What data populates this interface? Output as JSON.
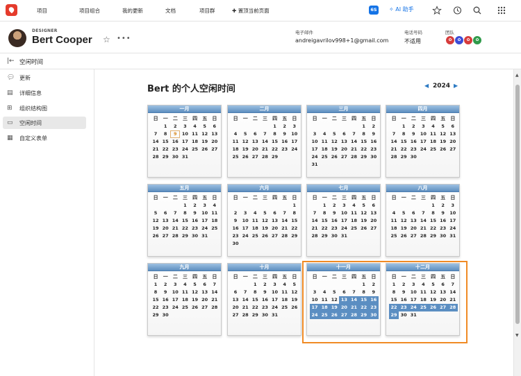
{
  "topnav": {
    "items": [
      "项目",
      "项目组合",
      "我的更新",
      "文档",
      "项目群"
    ],
    "pin_label": "置顶当前页面",
    "badge": "6S",
    "ai_label": "AI 助手"
  },
  "header": {
    "role": "DESIGNER",
    "name": "Bert Cooper",
    "email_label": "电子邮件",
    "email": "andreigavrilov998+1@gmail.com",
    "phone_label": "电话号码",
    "phone": "不适用",
    "team_label": "团队"
  },
  "subheader": {
    "title": "空闲时间"
  },
  "sidebar": {
    "items": [
      {
        "label": "更新",
        "icon": "chat-icon"
      },
      {
        "label": "详细信息",
        "icon": "document-icon"
      },
      {
        "label": "组织结构图",
        "icon": "org-chart-icon"
      },
      {
        "label": "空闲时间",
        "icon": "calendar-icon"
      },
      {
        "label": "自定义表单",
        "icon": "form-icon"
      }
    ],
    "active_index": 3
  },
  "main": {
    "title": "Bert 的个人空闲时间",
    "year": "2024"
  },
  "calendar": {
    "weekdays": [
      "日",
      "一",
      "二",
      "三",
      "四",
      "五",
      "日"
    ],
    "months": [
      {
        "name": "一月",
        "start": 1,
        "days": 31,
        "today": 9,
        "off": []
      },
      {
        "name": "二月",
        "start": 4,
        "days": 29,
        "off": []
      },
      {
        "name": "三月",
        "start": 5,
        "days": 31,
        "off": []
      },
      {
        "name": "四月",
        "start": 1,
        "days": 30,
        "off": []
      },
      {
        "name": "五月",
        "start": 3,
        "days": 31,
        "off": []
      },
      {
        "name": "六月",
        "start": 6,
        "days": 30,
        "off": []
      },
      {
        "name": "七月",
        "start": 1,
        "days": 31,
        "off": []
      },
      {
        "name": "八月",
        "start": 4,
        "days": 31,
        "off": []
      },
      {
        "name": "九月",
        "start": 0,
        "days": 30,
        "off": []
      },
      {
        "name": "十月",
        "start": 2,
        "days": 31,
        "off": []
      },
      {
        "name": "十一月",
        "start": 5,
        "days": 30,
        "off": [
          13,
          14,
          15,
          16,
          17,
          18,
          19,
          20,
          21,
          22,
          23,
          24,
          25,
          26,
          27,
          28,
          29,
          30
        ]
      },
      {
        "name": "十二月",
        "start": 0,
        "days": 31,
        "off": [
          22,
          23,
          24,
          25,
          26,
          27,
          28,
          29
        ]
      }
    ]
  },
  "colors": {
    "accent": "#1473e6",
    "time_off": "#5b8ec2",
    "highlight": "#f08a24",
    "month_header": "#6f9bc7"
  }
}
